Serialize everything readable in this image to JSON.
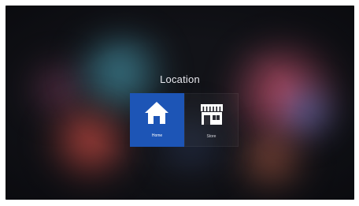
{
  "screen": {
    "title": "Location"
  },
  "options": [
    {
      "label": "Home",
      "icon": "house-icon",
      "selected": true
    },
    {
      "label": "Store",
      "icon": "storefront-icon",
      "selected": false
    }
  ],
  "colors": {
    "selected_tile": "#1d55b6",
    "background": "#121318",
    "text": "#e8e8ee"
  }
}
